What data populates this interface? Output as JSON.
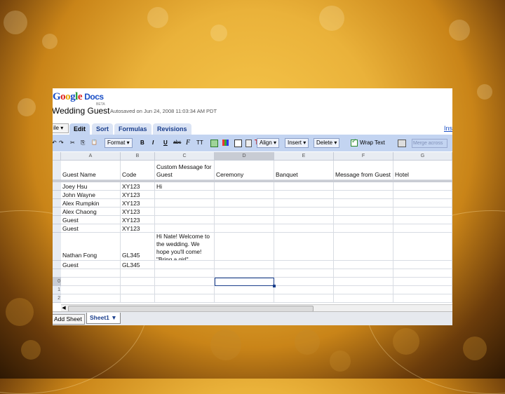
{
  "app": {
    "logo": [
      "G",
      "o",
      "o",
      "g",
      "l",
      "e"
    ],
    "logo_suffix": "Docs",
    "beta": "BETA",
    "doc_title": "Wedding Guest",
    "autosave": "Autosaved on Jun 24, 2008 11:03:34 AM PDT"
  },
  "menu": {
    "file": "ile",
    "tabs": [
      "Edit",
      "Sort",
      "Formulas",
      "Revisions"
    ],
    "right_link": "Ins"
  },
  "toolbar": {
    "undo": "↶",
    "redo": "↷",
    "cut": "✂",
    "copy": "⎘",
    "paste": "📋",
    "format": "Format",
    "bold": "B",
    "italic": "I",
    "underline": "U",
    "strike": "abc",
    "font": "F",
    "size": "TT",
    "align": "Align",
    "insert": "Insert",
    "delete": "Delete",
    "wrap_text": "Wrap Text",
    "merge_across": "Merge across",
    "wrap_checked": true
  },
  "columns": [
    "A",
    "B",
    "C",
    "D",
    "E",
    "F",
    "G"
  ],
  "headers": [
    "Guest Name",
    "Code",
    "Custom Message for Guest",
    "Ceremony",
    "Banquet",
    "Message from Guest",
    "Hotel"
  ],
  "row_numbers": [
    "",
    "",
    "",
    "",
    "",
    "",
    "",
    "",
    "",
    "0",
    "1",
    "2"
  ],
  "rows": [
    [
      "Joey Hsu",
      "XY123",
      "Hi",
      "",
      "",
      "",
      ""
    ],
    [
      "John Wayne",
      "XY123",
      "",
      "",
      "",
      "",
      ""
    ],
    [
      "Alex Rumpkin",
      "XY123",
      "",
      "",
      "",
      "",
      ""
    ],
    [
      "Alex Chaong",
      "XY123",
      "",
      "",
      "",
      "",
      ""
    ],
    [
      "Guest",
      "XY123",
      "",
      "",
      "",
      "",
      ""
    ],
    [
      "Guest",
      "XY123",
      "",
      "",
      "",
      "",
      ""
    ],
    [
      "Nathan Fong",
      "GL345",
      "Hi Nate! Welcome to the wedding. We hope you'll come! \"Bring a girl\"",
      "",
      "",
      "",
      ""
    ],
    [
      "Guest",
      "GL345",
      "",
      "",
      "",
      "",
      ""
    ],
    [
      "",
      "",
      "",
      "",
      "",
      "",
      ""
    ],
    [
      "",
      "",
      "",
      "",
      "",
      "",
      ""
    ],
    [
      "",
      "",
      "",
      "",
      "",
      "",
      ""
    ],
    [
      "",
      "",
      "",
      "",
      "",
      "",
      ""
    ]
  ],
  "sheets": {
    "add_sheet": "Add Sheet",
    "active": "Sheet1 ▼"
  }
}
